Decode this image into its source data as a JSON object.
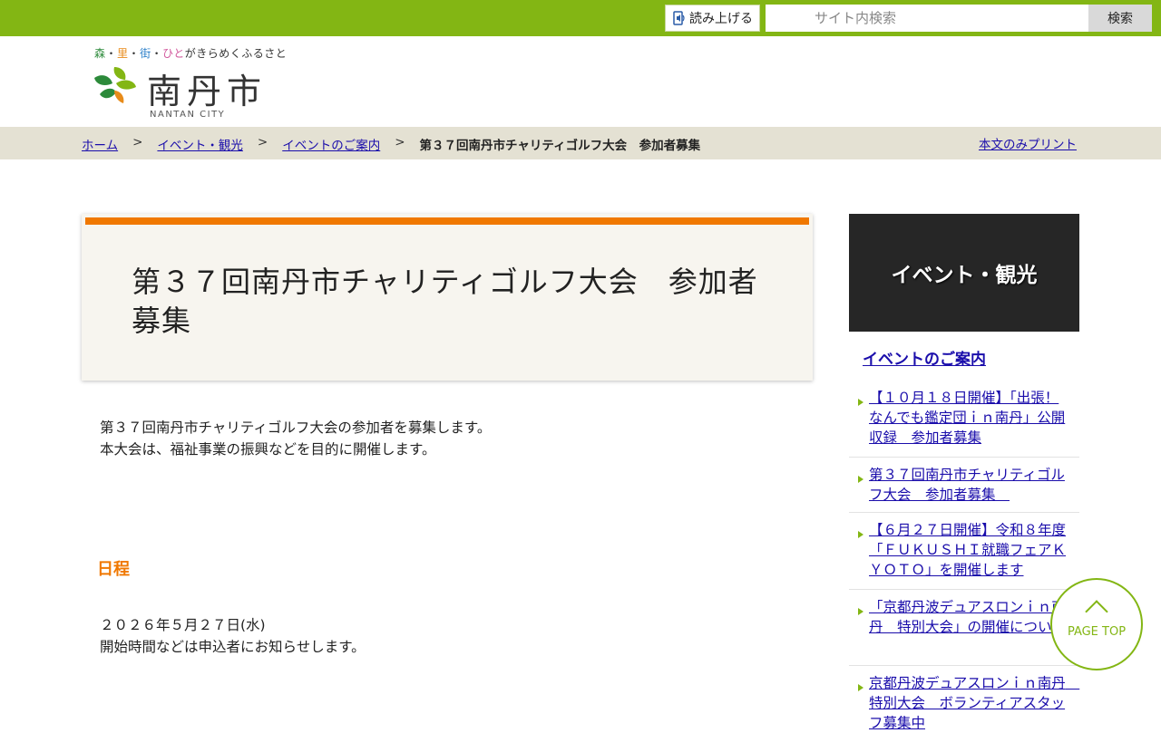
{
  "header": {
    "read_aloud_label": "読み上げる",
    "search_placeholder": "サイト内検索",
    "search_button": "検索",
    "tagline": [
      "森",
      "・",
      "里",
      "・",
      "街",
      "・",
      "ひと",
      "がきらめくふるさと"
    ],
    "site_name": "南丹市",
    "site_name_en": "NANTAN CITY"
  },
  "breadcrumb": {
    "items": [
      "ホーム",
      "イベント・観光",
      "イベントのご案内"
    ],
    "separator": ">",
    "current": "第３７回南丹市チャリティゴルフ大会　参加者募集",
    "print_link": "本文のみプリント"
  },
  "main": {
    "title": "第３７回南丹市チャリティゴルフ大会　参加者募集",
    "intro": [
      "第３７回南丹市チャリティゴルフ大会の参加者を募集します。",
      "本大会は、福祉事業の振興などを目的に開催します。"
    ],
    "schedule_heading": "日程",
    "schedule": [
      "２０２６年５月２７日(水)",
      "開始時間などは申込者にお知らせします。"
    ]
  },
  "sidebar": {
    "heading": "イベント・観光",
    "subheading": "イベントのご案内",
    "items": [
      "【１０月１８日開催】「出張！なんでも鑑定団ｉｎ南丹」公開収録　参加者募集",
      "第３７回南丹市チャリティゴルフ大会　参加者募集　",
      "【６月２７日開催】令和８年度「ＦＵＫＵＳＨＩ就職フェアＫＹＯＴＯ」を開催します",
      "「京都丹波デュアスロンｉｎ南丹　特別大会」の開催について",
      "京都丹波デュアスロンｉｎ南丹　特別大会　ボランティアスタッフ募集中"
    ]
  },
  "page_top": "PAGE TOP",
  "colors": {
    "brand_green": "#83b614",
    "accent_orange": "#f07800",
    "link_blue": "#1a0dab"
  }
}
